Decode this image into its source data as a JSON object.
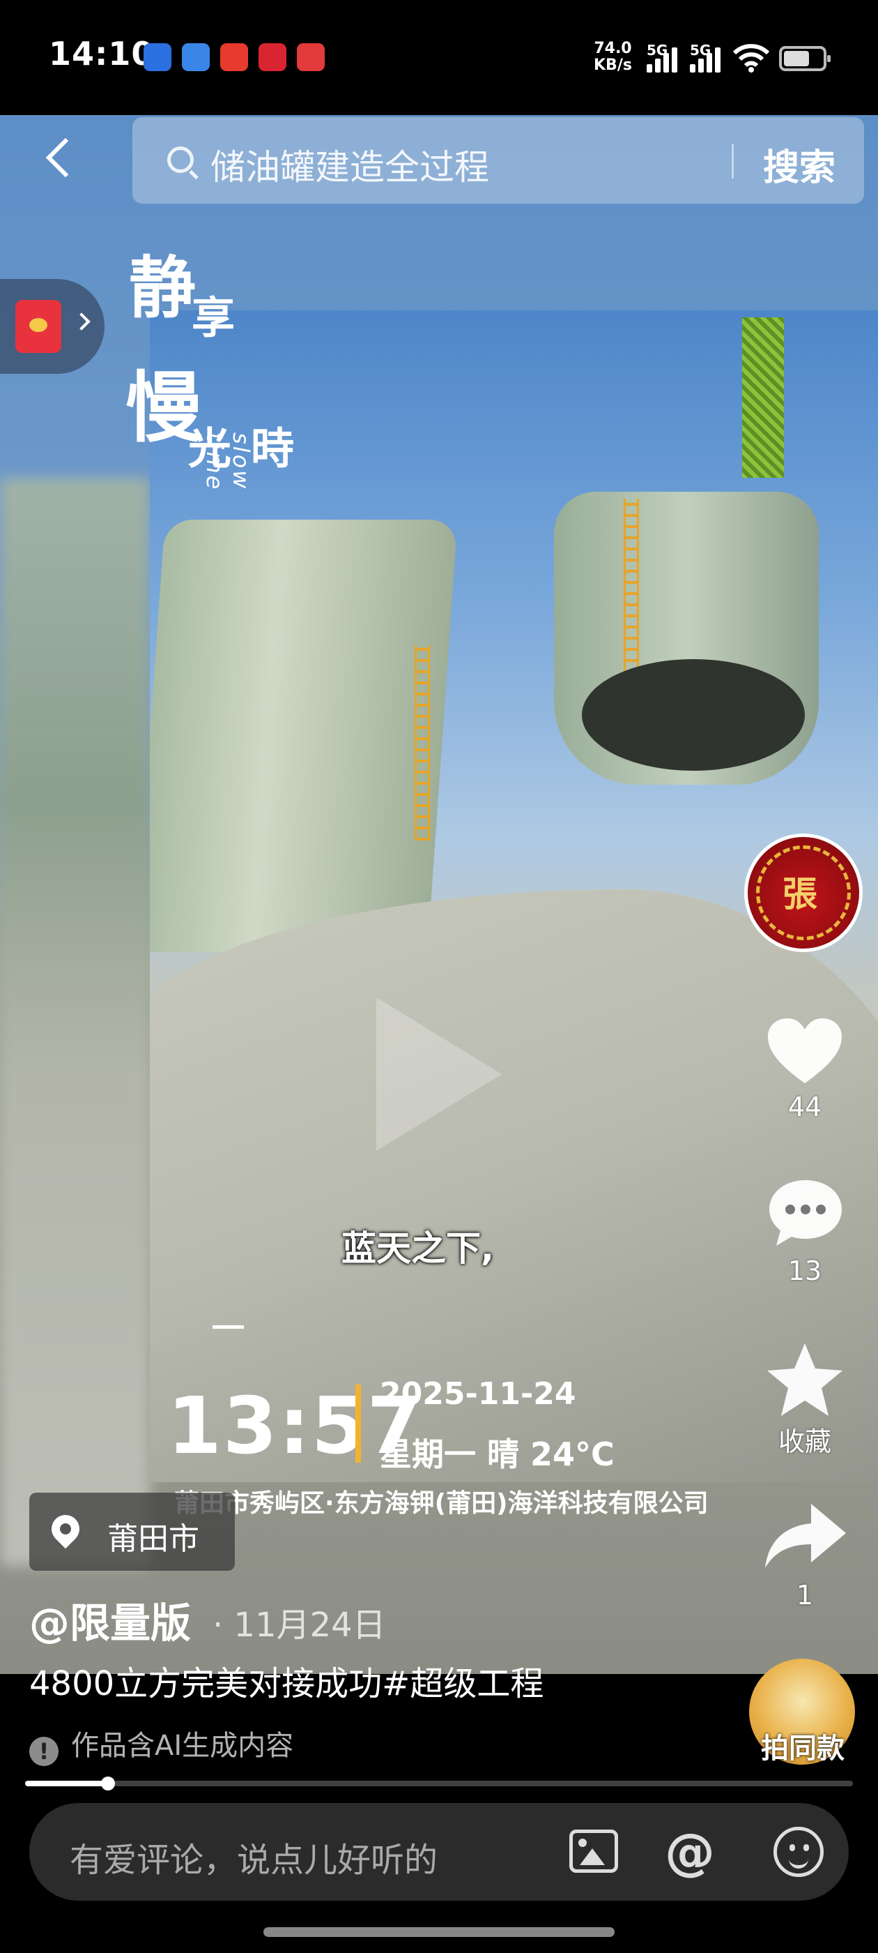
{
  "status_bar": {
    "time": "14:10",
    "net_speed_value": "74.0",
    "net_speed_unit": "KB/s",
    "signal_1": "5G",
    "signal_2": "5G",
    "battery_level_percent": 74,
    "notification_icons": [
      {
        "name": "k-app-icon",
        "color": "#2b6fe0"
      },
      {
        "name": "blue-app-icon",
        "color": "#3a86e8"
      },
      {
        "name": "red-app-icon",
        "color": "#e83a2e"
      },
      {
        "name": "bank-app-icon",
        "color": "#d82531"
      },
      {
        "name": "flower-app-icon",
        "color": "#e33b3b"
      }
    ]
  },
  "search": {
    "query": "储油罐建造全过程",
    "button": "搜索"
  },
  "video": {
    "overlay_title": {
      "c1": "静",
      "c2": "享",
      "c3": "慢",
      "c4": "時光",
      "en": "slow time"
    },
    "subtitle": "蓝天之下,",
    "watermark": {
      "time": "13:57",
      "date": "2025-11-24",
      "weekday_weather": "星期一  晴 24°C",
      "address": "莆田市秀屿区·东方海钾(莆田)海洋科技有限公司"
    },
    "progress_fraction": 0.1
  },
  "rail": {
    "avatar_char": "張",
    "likes": "44",
    "comments": "13",
    "favorite_label": "收藏",
    "shares": "1",
    "same_style_label": "拍同款"
  },
  "post": {
    "location": "莆田市",
    "author": "@限量版",
    "date": "· 11月24日",
    "caption": "4800立方完美对接成功#超级工程",
    "ai_note": "作品含AI生成内容",
    "ai_icon": "!"
  },
  "comment_bar": {
    "placeholder": "有爱评论，说点儿好听的"
  },
  "colors": {
    "accent_yellow": "#f3b330",
    "envelope_red": "#e8323d"
  }
}
